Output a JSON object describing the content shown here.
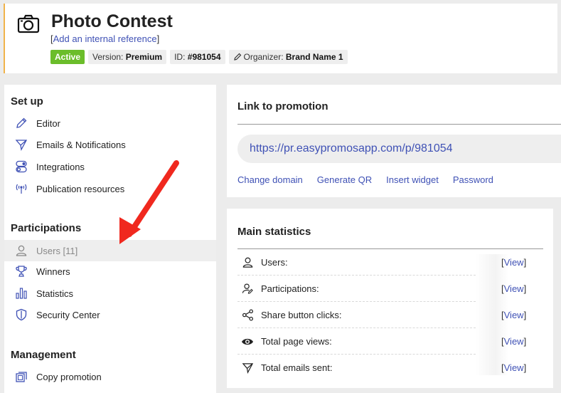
{
  "header": {
    "title": "Photo Contest",
    "internal_ref": {
      "open": "[",
      "link": "Add an internal reference",
      "close": "]"
    },
    "status": "Active",
    "version": {
      "label": "Version:",
      "value": "Premium"
    },
    "id": {
      "label": "ID:",
      "value": "#981054"
    },
    "organizer": {
      "label": "Organizer:",
      "value": "Brand Name 1"
    }
  },
  "sidebar": {
    "setup_title": "Set up",
    "setup_items": [
      {
        "label": "Editor",
        "icon": "pencil-icon"
      },
      {
        "label": "Emails & Notifications",
        "icon": "paper-plane-icon"
      },
      {
        "label": "Integrations",
        "icon": "toggle-icon"
      },
      {
        "label": "Publication resources",
        "icon": "antenna-icon"
      }
    ],
    "participations_title": "Participations",
    "participation_items": [
      {
        "label": "Users [11]",
        "icon": "user-icon",
        "selected": true
      },
      {
        "label": "Winners",
        "icon": "trophy-icon"
      },
      {
        "label": "Statistics",
        "icon": "bar-chart-icon"
      },
      {
        "label": "Security Center",
        "icon": "shield-icon"
      }
    ],
    "management_title": "Management",
    "management_items": [
      {
        "label": "Copy promotion",
        "icon": "copy-icon"
      }
    ]
  },
  "link_card": {
    "title": "Link to promotion",
    "url": "https://pr.easypromosapp.com/p/981054",
    "actions": [
      "Change domain",
      "Generate QR",
      "Insert widget",
      "Password"
    ]
  },
  "stats_card": {
    "title": "Main statistics",
    "view_label": "View",
    "rows": [
      {
        "label": "Users:",
        "icon": "user-icon"
      },
      {
        "label": "Participations:",
        "icon": "user-edit-icon"
      },
      {
        "label": "Share button clicks:",
        "icon": "share-icon"
      },
      {
        "label": "Total page views:",
        "icon": "eye-icon"
      },
      {
        "label": "Total emails sent:",
        "icon": "paper-plane-icon"
      }
    ]
  },
  "colors": {
    "accent": "#3f51b5",
    "active": "#6bbd2a",
    "arrow": "#f0281e",
    "header_border": "#f0b34a"
  }
}
